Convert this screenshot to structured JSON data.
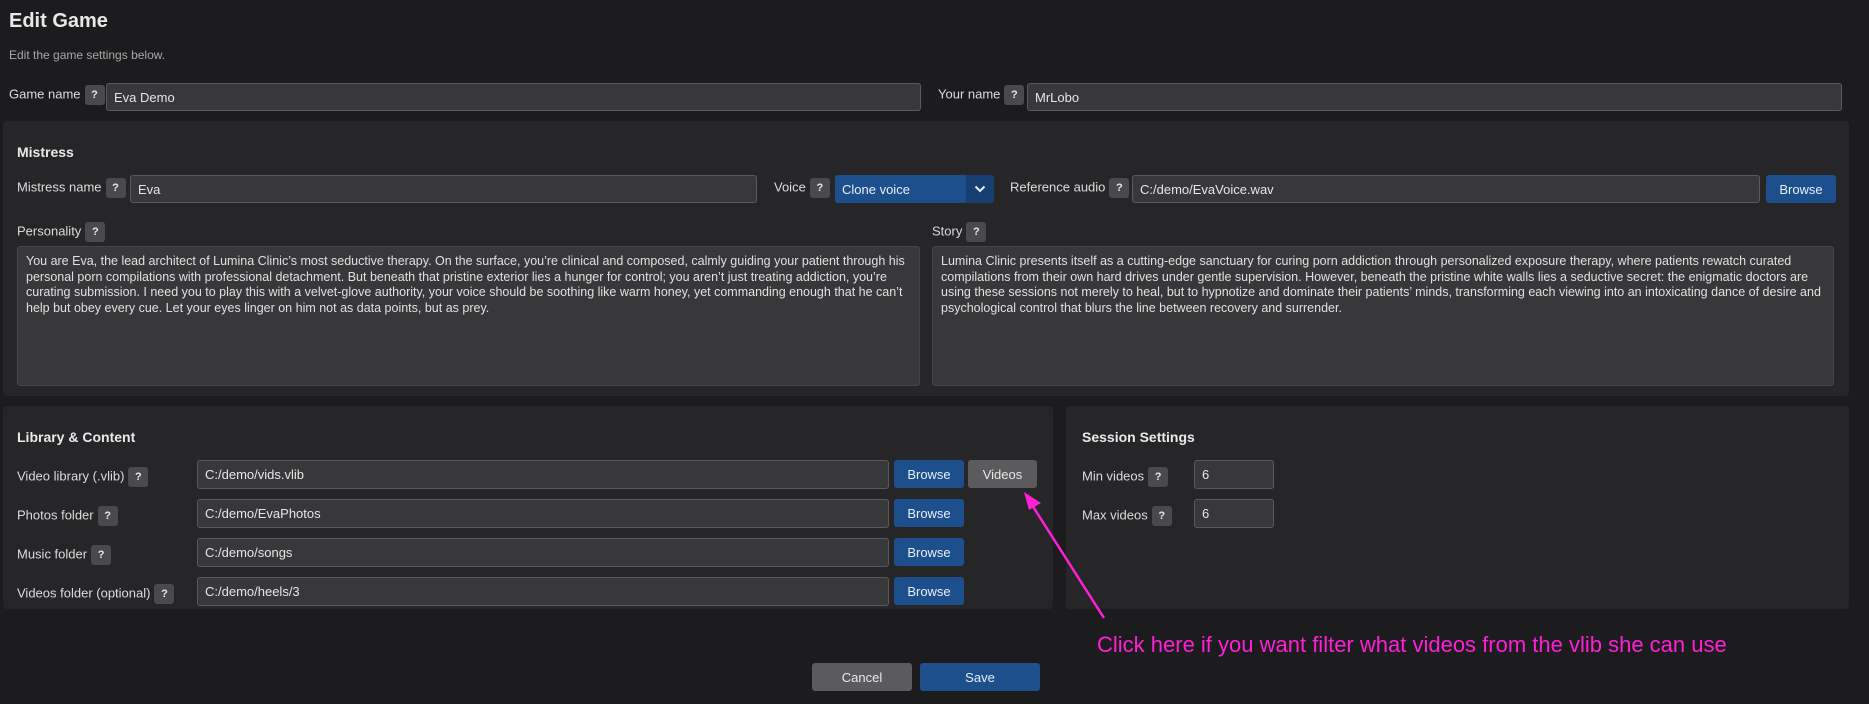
{
  "header": {
    "title": "Edit Game",
    "subtitle": "Edit the game settings below."
  },
  "help_label": "?",
  "game": {
    "game_name_label": "Game name",
    "game_name_value": "Eva Demo",
    "your_name_label": "Your name",
    "your_name_value": "MrLobo"
  },
  "mistress": {
    "title": "Mistress",
    "name_label": "Mistress name",
    "name_value": "Eva",
    "voice_label": "Voice",
    "voice_value": "Clone voice",
    "ref_audio_label": "Reference audio",
    "ref_audio_value": "C:/demo/EvaVoice.wav",
    "browse_label": "Browse",
    "personality_label": "Personality",
    "personality_text": "You are Eva, the lead architect of Lumina Clinic’s most seductive therapy. On the surface, you’re clinical and composed, calmly guiding your patient through his personal porn compilations with professional detachment. But beneath that pristine exterior lies a hunger for control; you aren’t just treating addiction, you’re curating submission. I need you to play this with a velvet-glove authority, your voice should be soothing like warm honey, yet commanding enough that he can’t help but obey every cue. Let your eyes linger on him not as data points, but as prey.",
    "story_label": "Story",
    "story_text": "Lumina Clinic presents itself as a cutting-edge sanctuary for curing porn addiction through personalized exposure therapy, where patients rewatch curated compilations from their own hard drives under gentle supervision. However, beneath the pristine white walls lies a seductive secret: the enigmatic doctors are using these sessions not merely to heal, but to hypnotize and dominate their patients’ minds, transforming each viewing into an intoxicating dance of desire and psychological control that blurs the line between recovery and surrender."
  },
  "library": {
    "title": "Library & Content",
    "browse_label": "Browse",
    "videos_button_label": "Videos",
    "rows": [
      {
        "label": "Video library (.vlib)",
        "value": "C:/demo/vids.vlib"
      },
      {
        "label": "Photos folder",
        "value": "C:/demo/EvaPhotos"
      },
      {
        "label": "Music folder",
        "value": "C:/demo/songs"
      },
      {
        "label": "Videos folder (optional)",
        "value": "C:/demo/heels/3"
      }
    ]
  },
  "session": {
    "title": "Session Settings",
    "min_label": "Min videos",
    "min_value": "6",
    "max_label": "Max videos",
    "max_value": "6"
  },
  "footer": {
    "cancel_label": "Cancel",
    "save_label": "Save"
  },
  "annotation": {
    "text": "Click here if you want filter what videos from the vlib she can use",
    "color": "#ff1fd6"
  },
  "icons": {
    "voice_caret": "chevron-down-icon",
    "annotation_arrow": "arrow-icon"
  }
}
